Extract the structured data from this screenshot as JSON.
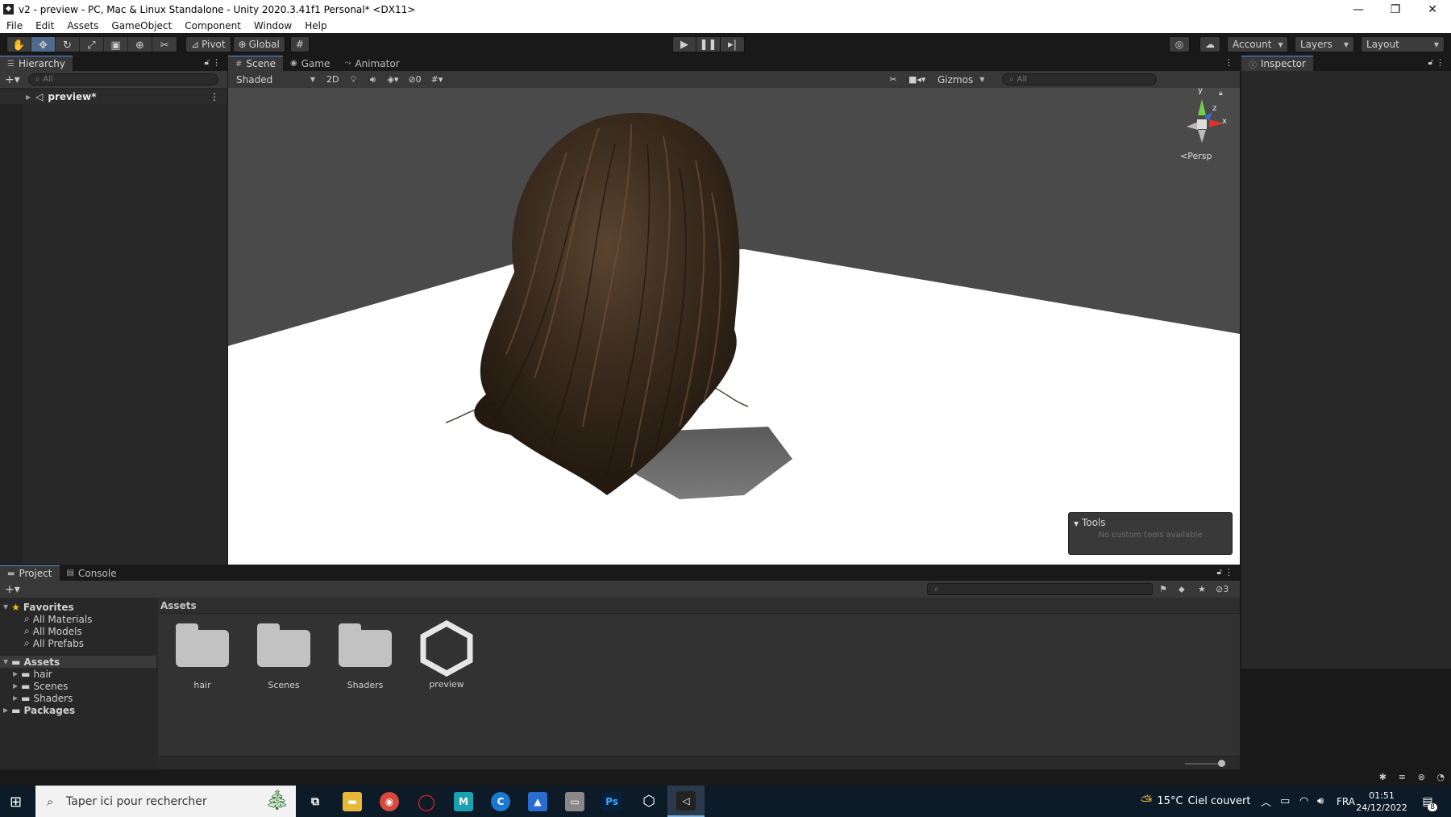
{
  "window": {
    "title": "v2 - preview - PC, Mac & Linux Standalone - Unity 2020.3.41f1 Personal* <DX11>",
    "minimize_glyph": "—",
    "maximize_glyph": "❐",
    "close_glyph": "✕"
  },
  "menu": [
    "File",
    "Edit",
    "Assets",
    "GameObject",
    "Component",
    "Window",
    "Help"
  ],
  "toolbar": {
    "pivot_label": "Pivot",
    "global_label": "Global",
    "account_label": "Account",
    "layers_label": "Layers",
    "layout_label": "Layout"
  },
  "hierarchy": {
    "tab_label": "Hierarchy",
    "search_placeholder": "All",
    "root_item": "preview*"
  },
  "scene": {
    "tabs": [
      "Scene",
      "Game",
      "Animator"
    ],
    "shading_mode": "Shaded",
    "mode_2d": "2D",
    "hidden_count": "0",
    "gizmos_label": "Gizmos",
    "search_placeholder": "All",
    "persp_label": "Persp",
    "axis_labels": {
      "y": "y",
      "z": "z",
      "x": "x"
    },
    "tools_overlay_title": "Tools",
    "tools_overlay_text": "No custom tools available"
  },
  "inspector": {
    "tab_label": "Inspector"
  },
  "project": {
    "tabs": [
      "Project",
      "Console"
    ],
    "hidden_count": "3",
    "favorites": {
      "label": "Favorites",
      "items": [
        "All Materials",
        "All Models",
        "All Prefabs"
      ]
    },
    "assets_tree": {
      "label": "Assets",
      "items": [
        "hair",
        "Scenes",
        "Shaders"
      ]
    },
    "packages_label": "Packages",
    "breadcrumb": "Assets",
    "grid_items": [
      {
        "label": "hair",
        "kind": "folder"
      },
      {
        "label": "Scenes",
        "kind": "folder"
      },
      {
        "label": "Shaders",
        "kind": "folder"
      },
      {
        "label": "preview",
        "kind": "unity-scene"
      }
    ],
    "zoom_level": 0.9
  },
  "taskbar": {
    "search_placeholder": "Taper ici pour rechercher",
    "weather_temp": "15°C",
    "weather_text": "Ciel couvert",
    "language": "FRA",
    "time": "01:51",
    "date": "24/12/2022",
    "notification_count": "8",
    "apps": [
      "task-view",
      "file-explorer",
      "chrome",
      "opera",
      "m-app",
      "c-app",
      "photos",
      "remote-app",
      "photoshop",
      "unity-hub",
      "unity-editor"
    ]
  },
  "colors": {
    "accent": "#5a8ad8",
    "panel_bg": "#282828",
    "toolbar_bg": "#191919",
    "taskbar_bg": "#0d1a28",
    "hair_dark": "#2b2016",
    "hair_mid": "#4e3a28"
  }
}
